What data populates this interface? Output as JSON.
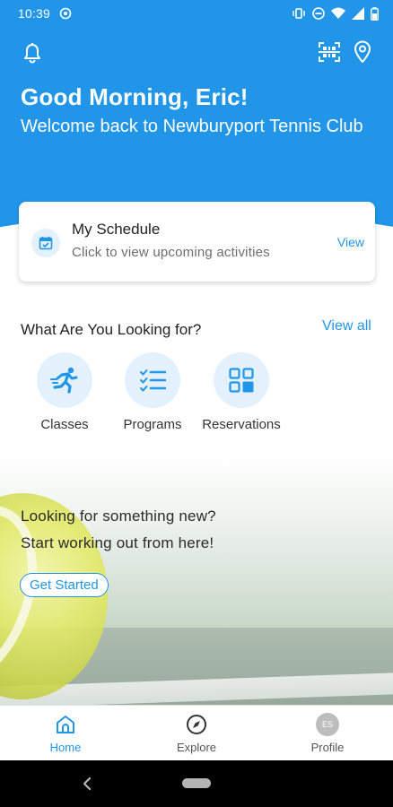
{
  "status_bar": {
    "time": "10:39"
  },
  "header": {
    "greeting": "Good Morning, Eric!",
    "welcome": "Welcome back to Newburyport Tennis Club",
    "icons": [
      "bell-icon",
      "qr-scan-icon",
      "location-pin-icon"
    ]
  },
  "schedule_card": {
    "title": "My Schedule",
    "subtitle": "Click to view upcoming activities",
    "view_label": "View",
    "icon": "calendar-icon"
  },
  "looking_for": {
    "title": "What Are You Looking for?",
    "view_all_label": "View all",
    "categories": [
      {
        "label": "Classes",
        "icon": "runner-icon"
      },
      {
        "label": "Programs",
        "icon": "checklist-icon"
      },
      {
        "label": "Reservations",
        "icon": "grid-icon"
      }
    ]
  },
  "promo": {
    "line1": "Looking for something new?",
    "line2": "Start working out from here!",
    "button_label": "Get Started"
  },
  "bottom_nav": {
    "items": [
      {
        "label": "Home",
        "icon": "home-icon",
        "active": true
      },
      {
        "label": "Explore",
        "icon": "compass-icon",
        "active": false
      },
      {
        "label": "Profile",
        "icon": "avatar",
        "active": false
      }
    ],
    "avatar_initials": "ES"
  },
  "colors": {
    "accent": "#2196e8",
    "icon_bg": "#e3f1fc"
  }
}
